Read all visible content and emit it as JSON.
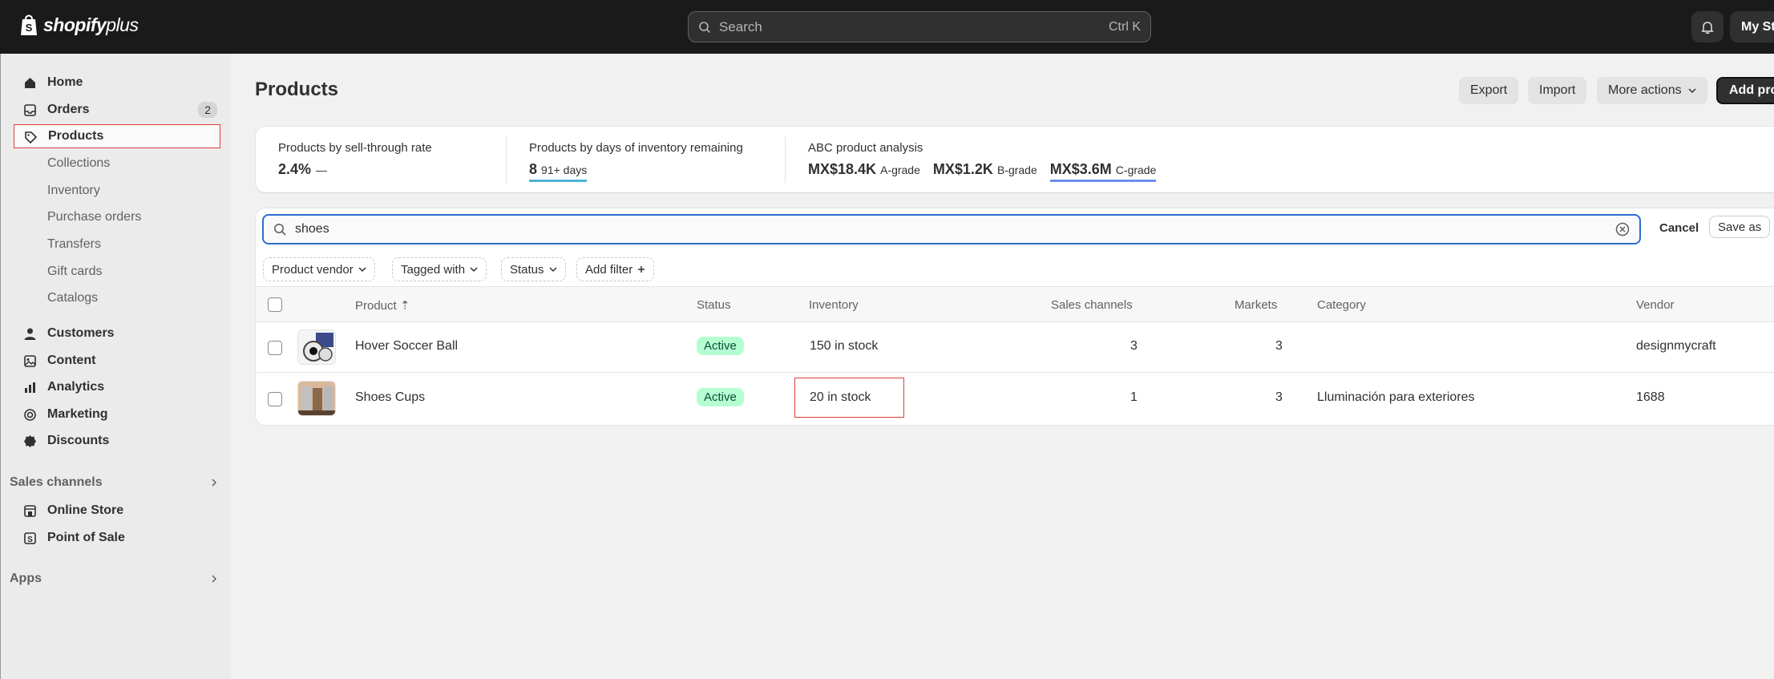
{
  "topbar": {
    "logo_text": "shopify",
    "logo_plus": "plus",
    "search_placeholder": "Search",
    "search_shortcut": "Ctrl K",
    "store_label": "My Store"
  },
  "sidebar": {
    "home": "Home",
    "orders": "Orders",
    "orders_badge": "2",
    "products": "Products",
    "sub": [
      "Collections",
      "Inventory",
      "Purchase orders",
      "Transfers",
      "Gift cards",
      "Catalogs"
    ],
    "customers": "Customers",
    "content": "Content",
    "analytics": "Analytics",
    "marketing": "Marketing",
    "discounts": "Discounts",
    "sales_channels": "Sales channels",
    "online_store": "Online Store",
    "point_of_sale": "Point of Sale",
    "apps": "Apps"
  },
  "header": {
    "title": "Products",
    "export": "Export",
    "import": "Import",
    "more_actions": "More actions",
    "add_product": "Add product"
  },
  "metrics": {
    "sell_through_label": "Products by sell-through rate",
    "sell_through_value": "2.4%",
    "sell_through_dash": "—",
    "days_label": "Products by days of inventory remaining",
    "days_count": "8",
    "days_bucket": "91+ days",
    "abc_label": "ABC product analysis",
    "a_value": "MX$18.4K",
    "a_grade": "A-grade",
    "b_value": "MX$1.2K",
    "b_grade": "B-grade",
    "c_value": "MX$3.6M",
    "c_grade": "C-grade"
  },
  "filter": {
    "query": "shoes",
    "cancel": "Cancel",
    "save_as": "Save as",
    "chips": [
      "Product vendor",
      "Tagged with",
      "Status",
      "Add filter"
    ]
  },
  "table": {
    "columns": [
      "Product",
      "Status",
      "Inventory",
      "Sales channels",
      "Markets",
      "Category",
      "Vendor"
    ],
    "rows": [
      {
        "product": "Hover Soccer Ball",
        "status": "Active",
        "inventory": "150 in stock",
        "sales_channels": "3",
        "markets": "3",
        "category": "",
        "vendor": "designmycraft"
      },
      {
        "product": "Shoes Cups",
        "status": "Active",
        "inventory": "20 in stock",
        "sales_channels": "1",
        "markets": "3",
        "category": "Lluminación para exteriores",
        "vendor": "1688"
      }
    ]
  },
  "colors": {
    "topbar": "#1a1a1a",
    "accent_focus": "#2c6ecb",
    "active_badge_bg": "#b4fed2",
    "highlight": "#e03c3c"
  }
}
